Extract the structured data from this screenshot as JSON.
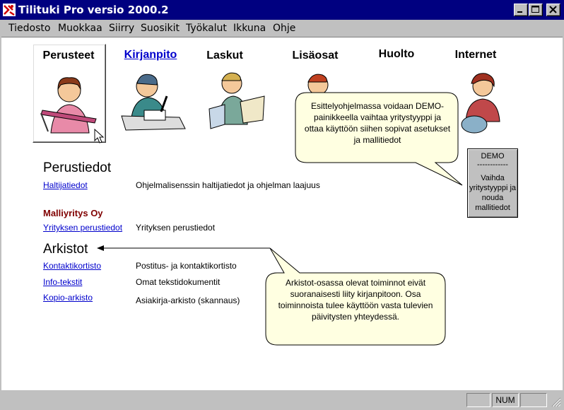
{
  "window": {
    "title": "Tilituki Pro versio 2000.2"
  },
  "menu": [
    "Tiedosto",
    "Muokkaa",
    "Siirry",
    "Suosikit",
    "Työkalut",
    "Ikkuna",
    "Ohje"
  ],
  "tabs": [
    {
      "label": "Perusteet",
      "selected": true,
      "icon": "person-writing-pen-icon"
    },
    {
      "label": "Kirjanpito",
      "link": true,
      "icon": "person-at-desk-icon"
    },
    {
      "label": "Laskut",
      "icon": "person-holding-papers-icon"
    },
    {
      "label": "Lisäosat",
      "icon": "person-pointing-icon"
    },
    {
      "label": "Huolto",
      "icon": "person-phone-icon"
    },
    {
      "label": "Internet",
      "icon": "person-globe-icon"
    }
  ],
  "perustiedot": {
    "heading": "Perustiedot",
    "rows": [
      {
        "link": "Haltijatiedot",
        "desc": "Ohjelmalisenssin haltijatiedot ja ohjelman laajuus"
      }
    ]
  },
  "company": {
    "name": "Malliyritys Oy",
    "rows": [
      {
        "link": "Yrityksen perustiedot",
        "desc": "Yrityksen perustiedot"
      }
    ]
  },
  "arkistot": {
    "heading": "Arkistot",
    "rows": [
      {
        "link": "Kontaktikortisto",
        "desc": "Postitus- ja kontaktikortisto"
      },
      {
        "link": "Info-tekstit",
        "desc": "Omat tekstidokumentit"
      },
      {
        "link": "Kopio-arkisto",
        "desc": "Asiakirja-arkisto (skannaus)"
      }
    ]
  },
  "balloons": {
    "demo_tip": "Esittelyohjelmassa voidaan DEMO-painikkeella vaihtaa yritystyyppi ja ottaa käyttöön siihen sopivat asetukset ja mallitiedot",
    "archive_tip": "Arkistot-osassa olevat toiminnot eivät suoranaisesti liity kirjanpitoon. Osa toiminnoista tulee käyttöön vasta tulevien päivitysten yhteydessä."
  },
  "demo_button": {
    "title": "DEMO",
    "separator": "------------",
    "body": "Vaihda yritystyyppi ja nouda mallitiedot"
  },
  "statusbar": {
    "panes": [
      "",
      "NUM",
      ""
    ]
  },
  "colors": {
    "titlebar": "#000080",
    "link": "#0000cc",
    "company": "#800000",
    "balloon": "#ffffe1"
  }
}
